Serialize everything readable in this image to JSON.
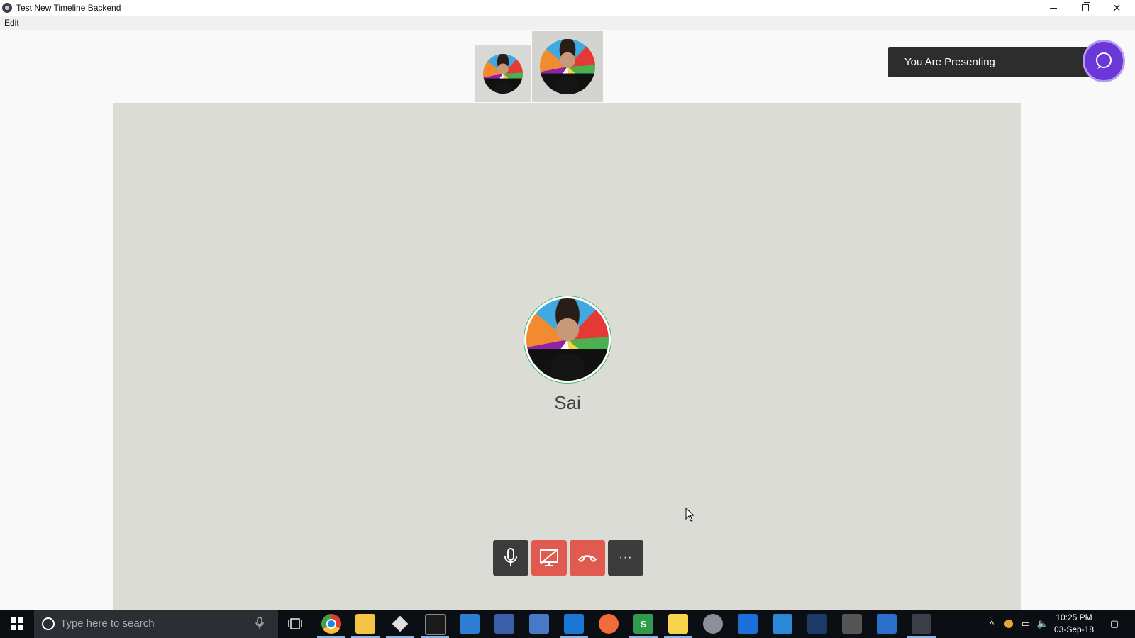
{
  "window": {
    "title": "Test New Timeline Backend",
    "menu": [
      "Edit"
    ]
  },
  "call": {
    "participant_name": "Sai",
    "presenting_label": "You Are Presenting",
    "more_label": "···"
  },
  "taskbar": {
    "search_placeholder": "Type here to search",
    "time": "10:25 PM",
    "date": "03-Sep-18",
    "apps": [
      "chrome-icon",
      "file-explorer-icon",
      "git-icon",
      "terminal-icon",
      "azure-data-studio-icon",
      "pen-app-icon",
      "remote-desktop-icon",
      "vscode-icon",
      "postman-icon",
      "s-app-icon",
      "sticky-notes-icon",
      "paint-icon",
      "shark-app-icon",
      "windows-app-icon",
      "wireshark-icon",
      "terminal-app-icon",
      "store-icon",
      "electron-app-icon"
    ]
  },
  "colors": {
    "stage": "#dcdcd7",
    "danger": "#e05a4f",
    "dark_btn": "#3c3c3c",
    "accent": "#6b37d6",
    "ring": "#3fb36c"
  }
}
